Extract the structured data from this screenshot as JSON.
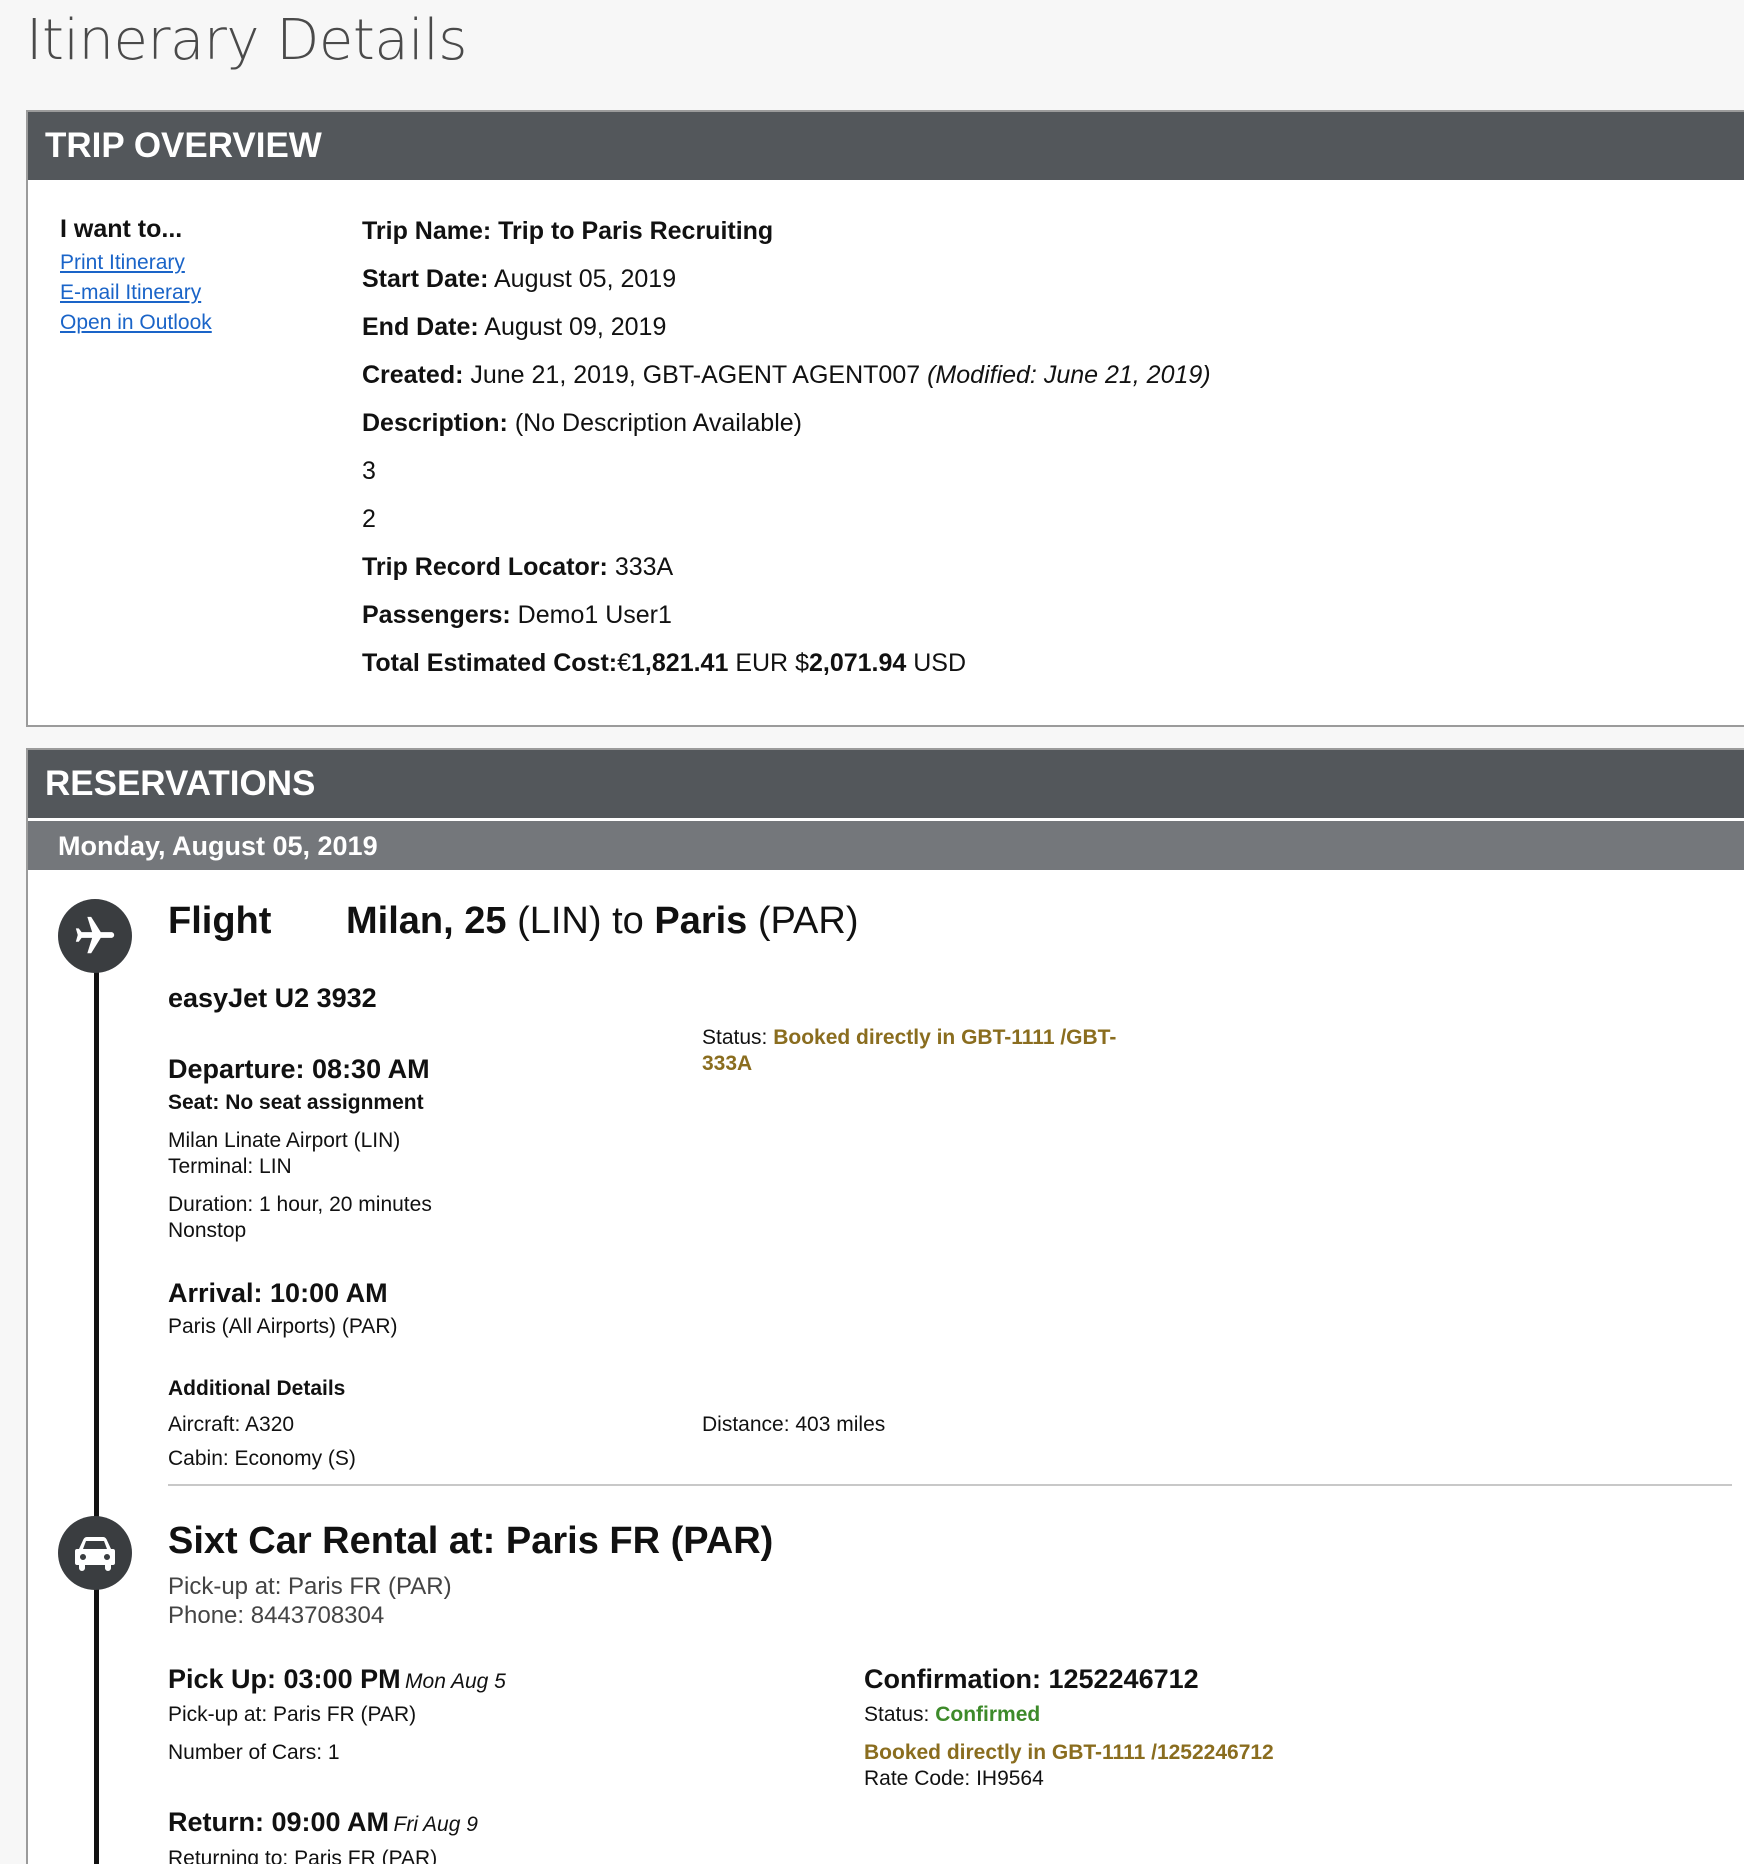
{
  "page": {
    "title": "Itinerary Details"
  },
  "overview": {
    "header": "TRIP OVERVIEW",
    "want_to": {
      "title": "I want to...",
      "links": [
        "Print Itinerary",
        "E-mail Itinerary",
        "Open in Outlook"
      ]
    },
    "trip_name_label": "Trip Name:",
    "trip_name": "Trip to Paris Recruiting",
    "start_date_label": "Start Date:",
    "start_date": "August 05, 2019",
    "end_date_label": "End Date:",
    "end_date": "August 09, 2019",
    "created_label": "Created:",
    "created": "June 21, 2019, GBT-AGENT AGENT007",
    "modified": "(Modified: June 21, 2019)",
    "description_label": "Description:",
    "description": "(No Description Available)",
    "line3": "3",
    "line2": "2",
    "record_locator_label": "Trip Record Locator:",
    "record_locator": "333A",
    "passengers_label": "Passengers:",
    "passengers": "Demo1 User1",
    "cost_label": "Total Estimated Cost:",
    "cost_eur_symbol": "€",
    "cost_eur": "1,821.41",
    "cost_eur_unit": "EUR",
    "cost_usd_symbol": "$",
    "cost_usd": "2,071.94",
    "cost_usd_unit": "USD"
  },
  "reservations": {
    "header": "RESERVATIONS",
    "day": "Monday, August 05, 2019",
    "flight": {
      "type_label": "Flight",
      "from_city": "Milan, 25",
      "from_code": "(LIN)",
      "to_word": "to",
      "to_city": "Paris",
      "to_code": "(PAR)",
      "carrier": "easyJet U2 3932",
      "status_label": "Status:",
      "status_value_1": "Booked directly in GBT-1111 /GBT-",
      "status_value_2": "333A",
      "departure": "Departure: 08:30 AM",
      "seat_label": "Seat:",
      "seat": "No seat assignment",
      "dep_airport": "Milan Linate Airport (LIN)",
      "terminal": "Terminal: LIN",
      "duration": "Duration: 1 hour, 20 minutes",
      "stops": "Nonstop",
      "arrival": "Arrival: 10:00 AM",
      "arr_airport": "Paris (All Airports) (PAR)",
      "additional_title": "Additional Details",
      "aircraft": "Aircraft: A320",
      "distance": "Distance: 403 miles",
      "cabin": "Cabin: Economy (S)"
    },
    "car": {
      "title": "Sixt Car Rental at: Paris FR (PAR)",
      "pickup_location": "Pick-up at: Paris FR (PAR)",
      "phone": "Phone: 8443708304",
      "pickup_time": "Pick Up: 03:00 PM",
      "pickup_date": "Mon Aug 5",
      "pickup_at": "Pick-up at: Paris FR (PAR)",
      "num_cars": "Number of Cars: 1",
      "confirmation": "Confirmation: 1252246712",
      "status_label": "Status:",
      "status": "Confirmed",
      "booked": "Booked directly in GBT-1111 /1252246712",
      "rate_code": "Rate Code: IH9564",
      "return_time": "Return: 09:00 AM",
      "return_date": "Fri Aug 9",
      "returning_to": "Returning to: Paris FR (PAR)"
    }
  },
  "colors": {
    "header_bg": "#53575b",
    "day_bar_bg": "#74777b",
    "link": "#1a64c8",
    "status_booked": "#8a6d1f",
    "status_confirmed": "#3d8a2a"
  },
  "icons": {
    "flight": "airplane-icon",
    "car": "car-icon"
  }
}
